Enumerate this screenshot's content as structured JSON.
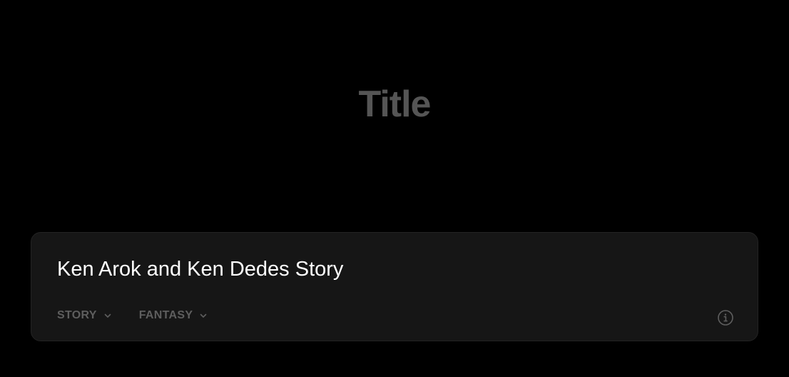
{
  "header": {
    "title": "Title"
  },
  "card": {
    "prompt": "Ken Arok and Ken Dedes Story",
    "dropdowns": [
      {
        "label": "STORY"
      },
      {
        "label": "FANTASY"
      }
    ],
    "info_icon": "info-circle-icon"
  },
  "colors": {
    "background": "#000000",
    "card_background": "#161616",
    "title": "#555555",
    "muted_text": "#5e5e5e",
    "primary_text": "#ffffff"
  }
}
